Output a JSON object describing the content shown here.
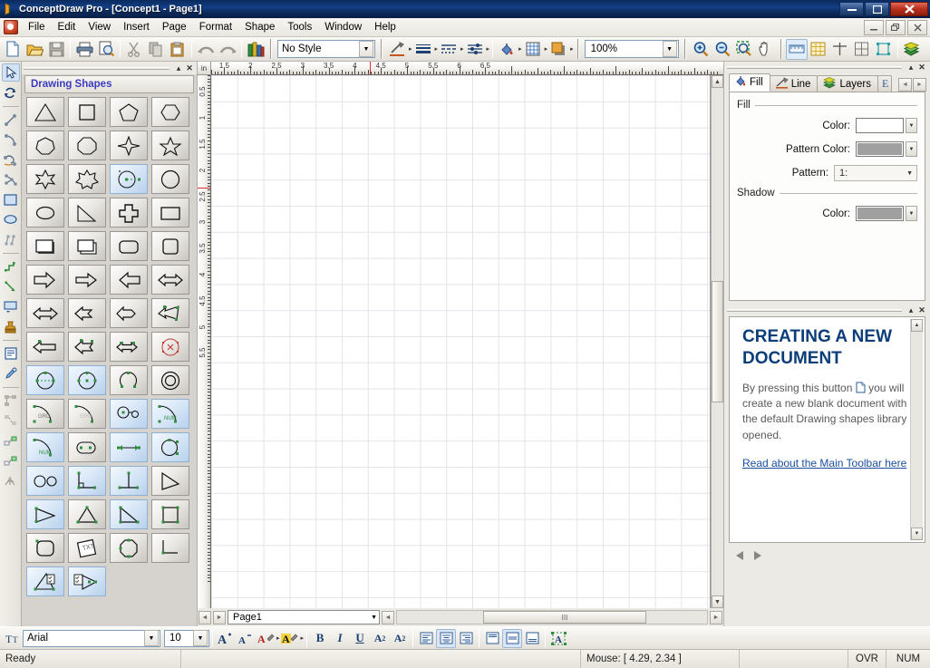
{
  "window": {
    "title": "ConceptDraw Pro - [Concept1 - Page1]",
    "minimize_label": "—",
    "maximize_label": "❐",
    "close_label": "✕",
    "mdi_minimize": "_",
    "mdi_restore": "❐",
    "mdi_close": "✕"
  },
  "menu": {
    "items": [
      {
        "label": "File"
      },
      {
        "label": "Edit"
      },
      {
        "label": "View"
      },
      {
        "label": "Insert"
      },
      {
        "label": "Page"
      },
      {
        "label": "Format"
      },
      {
        "label": "Shape"
      },
      {
        "label": "Tools"
      },
      {
        "label": "Window"
      },
      {
        "label": "Help"
      }
    ]
  },
  "toolbar": {
    "style_value": "No Style",
    "zoom_value": "100%",
    "dropdown_arrow": "▼",
    "buttons": [
      {
        "name": "new-document-button",
        "tip": "New"
      },
      {
        "name": "open-document-button",
        "tip": "Open"
      },
      {
        "name": "save-document-button",
        "tip": "Save"
      },
      {
        "name": "print-button",
        "tip": "Print"
      },
      {
        "name": "print-preview-button",
        "tip": "Print Preview"
      },
      {
        "name": "cut-button",
        "tip": "Cut"
      },
      {
        "name": "copy-button",
        "tip": "Copy"
      },
      {
        "name": "paste-button",
        "tip": "Paste"
      },
      {
        "name": "undo-button",
        "tip": "Undo"
      },
      {
        "name": "redo-button",
        "tip": "Redo"
      },
      {
        "name": "libraries-button",
        "tip": "Libraries"
      },
      {
        "name": "line-style-button",
        "tip": "Line Style"
      },
      {
        "name": "line-weight-button",
        "tip": "Line Weight"
      },
      {
        "name": "line-pattern-button",
        "tip": "Line Pattern"
      },
      {
        "name": "line-ends-button",
        "tip": "Line Ends"
      },
      {
        "name": "fill-color-button",
        "tip": "Fill Color"
      },
      {
        "name": "fill-pattern-button",
        "tip": "Fill Pattern"
      },
      {
        "name": "shadow-button",
        "tip": "Shadow"
      },
      {
        "name": "zoom-in-button",
        "tip": "Zoom In"
      },
      {
        "name": "zoom-out-button",
        "tip": "Zoom Out"
      },
      {
        "name": "zoom-region-button",
        "tip": "Zoom Region"
      },
      {
        "name": "pan-button",
        "tip": "Pan"
      },
      {
        "name": "rulers-button",
        "tip": "Rulers"
      },
      {
        "name": "grid-button",
        "tip": "Grid"
      },
      {
        "name": "guides-button",
        "tip": "Guides"
      },
      {
        "name": "page-breaks-button",
        "tip": "Page Breaks"
      },
      {
        "name": "connection-points-button",
        "tip": "Connection Points"
      },
      {
        "name": "layers-button",
        "tip": "Layers"
      }
    ]
  },
  "tools_strip": {
    "items": [
      {
        "name": "select-tool",
        "selected": true
      },
      {
        "name": "rotate-tool",
        "selected": false
      },
      {
        "name": "line-tool",
        "selected": false
      },
      {
        "name": "arc-tool",
        "selected": false
      },
      {
        "name": "freeform-tool",
        "selected": false
      },
      {
        "name": "polyline-tool",
        "selected": false
      },
      {
        "name": "rectangle-tool",
        "selected": false
      },
      {
        "name": "ellipse-tool",
        "selected": false
      },
      {
        "name": "connector-tool",
        "selected": false
      },
      {
        "name": "smart-connector-tool",
        "selected": false
      },
      {
        "name": "direct-connector-tool",
        "selected": false
      },
      {
        "name": "text-block-tool",
        "selected": false
      },
      {
        "name": "stamp-tool",
        "selected": false
      },
      {
        "name": "text-tool",
        "selected": false
      },
      {
        "name": "eyedropper-tool",
        "selected": false
      },
      {
        "name": "group-tool",
        "selected": false
      },
      {
        "name": "ungroup-tool",
        "selected": false
      },
      {
        "name": "align-tool",
        "selected": false
      },
      {
        "name": "distribute-tool",
        "selected": false
      },
      {
        "name": "hyperlink-tool",
        "selected": false
      }
    ]
  },
  "shapes_panel": {
    "library_title": "Drawing Shapes",
    "collapse_label": "▴",
    "close_label": "✕",
    "shapes": [
      {
        "name": "triangle-shape",
        "highlighted": false
      },
      {
        "name": "square-shape",
        "highlighted": false
      },
      {
        "name": "pentagon-shape",
        "highlighted": false
      },
      {
        "name": "hexagon-shape",
        "highlighted": false
      },
      {
        "name": "heptagon-shape",
        "highlighted": false
      },
      {
        "name": "octagon-shape",
        "highlighted": false
      },
      {
        "name": "four-point-star-shape",
        "highlighted": false
      },
      {
        "name": "five-point-star-shape",
        "highlighted": false
      },
      {
        "name": "six-point-star-shape",
        "highlighted": false
      },
      {
        "name": "seven-point-star-shape",
        "highlighted": false
      },
      {
        "name": "circle-radius-shape",
        "highlighted": true
      },
      {
        "name": "circle-shape",
        "highlighted": false
      },
      {
        "name": "ellipse-shape",
        "highlighted": false
      },
      {
        "name": "right-triangle-shape",
        "highlighted": false
      },
      {
        "name": "cross-shape",
        "highlighted": false
      },
      {
        "name": "rectangle-shape",
        "highlighted": false
      },
      {
        "name": "shadow-rectangle-shape",
        "highlighted": false
      },
      {
        "name": "stacked-rectangle-shape",
        "highlighted": false
      },
      {
        "name": "rounded-rectangle-shape",
        "highlighted": false
      },
      {
        "name": "rounded-square-shape",
        "highlighted": false
      },
      {
        "name": "arrow-right-shape",
        "highlighted": false
      },
      {
        "name": "arrow-right-2-shape",
        "highlighted": false
      },
      {
        "name": "arrow-left-shape",
        "highlighted": false
      },
      {
        "name": "double-arrow-shape",
        "highlighted": false
      },
      {
        "name": "double-arrow-2-shape",
        "highlighted": false
      },
      {
        "name": "fletched-arrow-left-shape",
        "highlighted": false
      },
      {
        "name": "notched-double-arrow-shape",
        "highlighted": false
      },
      {
        "name": "tapered-arrow-shape",
        "highlighted": true
      },
      {
        "name": "block-arrow-left-shape",
        "highlighted": true
      },
      {
        "name": "fletched-arrow-shape",
        "highlighted": true
      },
      {
        "name": "double-headed-arrow-shape",
        "highlighted": true
      },
      {
        "name": "circle-cross-shape",
        "highlighted": false
      },
      {
        "name": "circle-diameter-shape",
        "highlighted": true
      },
      {
        "name": "circle-center-shape",
        "highlighted": true
      },
      {
        "name": "arc-sector-shape",
        "highlighted": false
      },
      {
        "name": "concentric-circles-shape",
        "highlighted": false
      },
      {
        "name": "arc-grad-shape",
        "highlighted": false
      },
      {
        "name": "arc-grad-2-shape",
        "highlighted": false
      },
      {
        "name": "two-circles-link-shape",
        "highlighted": true
      },
      {
        "name": "arc-num-shape",
        "highlighted": true
      },
      {
        "name": "arc-num-2-shape",
        "highlighted": true
      },
      {
        "name": "oval-two-points-shape",
        "highlighted": false
      },
      {
        "name": "dimension-line-shape",
        "highlighted": true
      },
      {
        "name": "circle-tangent-shape",
        "highlighted": true
      },
      {
        "name": "infinity-shape",
        "highlighted": true
      },
      {
        "name": "right-angle-shape",
        "highlighted": true
      },
      {
        "name": "angle-lines-shape",
        "highlighted": true
      },
      {
        "name": "triangle-outline-shape",
        "highlighted": false
      },
      {
        "name": "narrow-triangle-shape",
        "highlighted": true
      },
      {
        "name": "isoceles-triangle-shape",
        "highlighted": false
      },
      {
        "name": "right-triangle-2-shape",
        "highlighted": true
      },
      {
        "name": "square-nodes-shape",
        "highlighted": false
      },
      {
        "name": "rounded-box-shape",
        "highlighted": false
      },
      {
        "name": "rotated-text-box-shape",
        "highlighted": false
      },
      {
        "name": "octagon-nodes-shape",
        "highlighted": false
      },
      {
        "name": "corner-line-shape",
        "highlighted": false
      },
      {
        "name": "triangle-checklist-shape",
        "highlighted": true
      },
      {
        "name": "checklist-arrow-shape",
        "highlighted": true
      }
    ]
  },
  "canvas": {
    "unit_label": "in",
    "h_ruler_labels": [
      "1.5",
      "2",
      "2.5",
      "3",
      "3.5",
      "4",
      "4.5",
      "5",
      "5.5",
      "6",
      "6.5"
    ],
    "v_ruler_labels": [
      "0.5",
      "1",
      "1.5",
      "2",
      "2.5",
      "3",
      "3.5",
      "4",
      "4.5",
      "5",
      "5.5"
    ],
    "page_tab": "Page1",
    "prev_page_label": "◄",
    "next_page_label": "►",
    "page_combo_arrow": "▼",
    "hscroll_left": "◄",
    "hscroll_right": "►",
    "hscroll_grip": "III",
    "vscroll_up": "▲",
    "vscroll_down": "▼"
  },
  "right_dock": {
    "collapse_label": "▴",
    "close_label": "✕",
    "tabs": [
      {
        "label": "Fill",
        "icon": "fill-bucket-icon",
        "active": true
      },
      {
        "label": "Line",
        "icon": "pen-icon",
        "active": false
      },
      {
        "label": "Layers",
        "icon": "layers-icon",
        "active": false
      },
      {
        "label": "",
        "icon": "text-icon",
        "active": false
      }
    ],
    "tab_prev": "◄",
    "tab_next": "►",
    "fill": {
      "group_label": "Fill",
      "color_label": "Color:",
      "color_value": "#ffffff",
      "pattern_color_label": "Pattern Color:",
      "pattern_color_value": "#a0a0a0",
      "pattern_label": "Pattern:",
      "pattern_value": "1:",
      "shadow_group_label": "Shadow",
      "shadow_color_label": "Color:",
      "shadow_color_value": "#a0a0a0",
      "dropdown_arrow": "▼"
    },
    "help": {
      "title": "CREATING A NEW DOCUMENT",
      "body_before": "By pressing this button",
      "body_after": "you will create a new blank document with the default Drawing shapes library opened.",
      "link": "Read about the Main Toolbar here",
      "prev_label": "◄",
      "next_label": "►"
    }
  },
  "font_bar": {
    "font_name": "Arial",
    "font_size": "10",
    "dropdown_arrow": "▼",
    "buttons": [
      {
        "name": "increase-font-size-button",
        "label": "A"
      },
      {
        "name": "decrease-font-size-button",
        "label": "A"
      },
      {
        "name": "font-color-button",
        "label": "A"
      },
      {
        "name": "text-highlight-button",
        "label": "A"
      },
      {
        "name": "bold-button",
        "label": "B"
      },
      {
        "name": "italic-button",
        "label": "I"
      },
      {
        "name": "underline-button",
        "label": "U"
      },
      {
        "name": "superscript-button",
        "label": "A²"
      },
      {
        "name": "subscript-button",
        "label": "A₂"
      },
      {
        "name": "align-left-button",
        "label": ""
      },
      {
        "name": "align-center-button",
        "label": ""
      },
      {
        "name": "align-right-button",
        "label": ""
      },
      {
        "name": "align-top-button",
        "label": ""
      },
      {
        "name": "align-middle-button",
        "label": ""
      },
      {
        "name": "align-bottom-button",
        "label": ""
      },
      {
        "name": "text-frame-button",
        "label": ""
      }
    ]
  },
  "status_bar": {
    "ready_text": "Ready",
    "mouse_text": "Mouse: [ 4.29, 2.34 ]",
    "ovr_text": "OVR",
    "num_text": "NUM"
  }
}
